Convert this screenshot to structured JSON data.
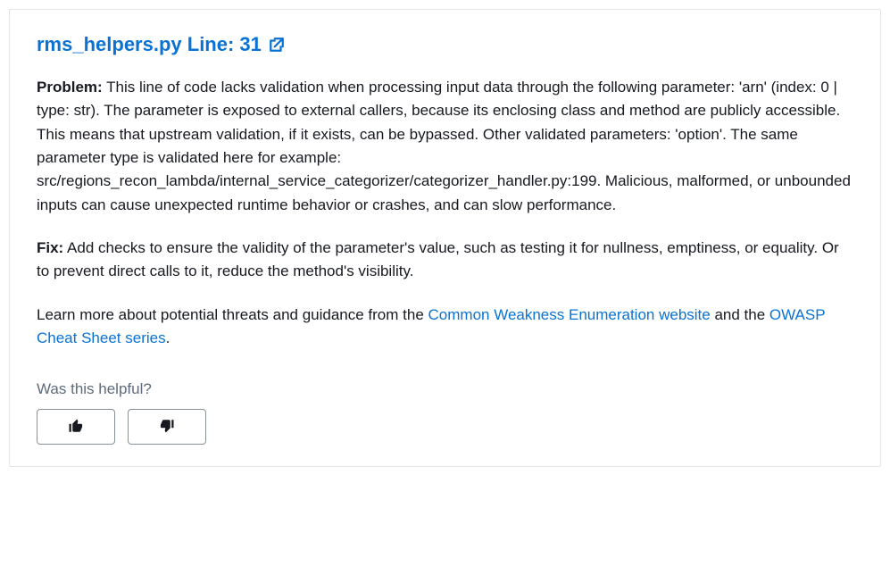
{
  "title": {
    "text": "rms_helpers.py Line: 31"
  },
  "problem": {
    "label": "Problem:",
    "text": " This line of code lacks validation when processing input data through the following parameter: 'arn' (index: 0 | type: str). The parameter is exposed to external callers, because its enclosing class and method are publicly accessible. This means that upstream validation, if it exists, can be bypassed. Other validated parameters: 'option'. The same parameter type is validated here for example: src/regions_recon_lambda/internal_service_categorizer/categorizer_handler.py:199. Malicious, malformed, or unbounded inputs can cause unexpected runtime behavior or crashes, and can slow performance."
  },
  "fix": {
    "label": "Fix:",
    "text": " Add checks to ensure the validity of the parameter's value, such as testing it for nullness, emptiness, or equality. Or to prevent direct calls to it, reduce the method's visibility."
  },
  "learn_more": {
    "prefix": "Learn more about potential threats and guidance from the ",
    "link1": "Common Weakness Enumeration website",
    "middle": " and the ",
    "link2": "OWASP Cheat Sheet series",
    "suffix": "."
  },
  "feedback": {
    "question": "Was this helpful?"
  }
}
